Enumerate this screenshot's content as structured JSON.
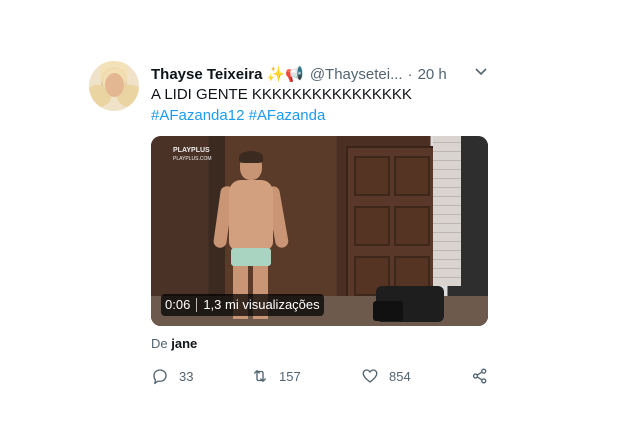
{
  "tweet": {
    "author_name": "Thayse Teixeira",
    "author_emojis": "✨📢",
    "handle": "@Thaysetei...",
    "separator": "·",
    "time": "20 h",
    "text": "A LIDI GENTE KKKKKKKKKKKKKKKK",
    "hashtags": [
      "#AFazanda12",
      "#AFazanda"
    ],
    "video": {
      "logo_text": "PLAYPLUS",
      "logo_sub": "PLAYPLUS.COM",
      "duration": "0:06",
      "views": "1,3 mi visualizações"
    },
    "via_prefix": "De",
    "via_source": "jane",
    "actions": {
      "replies": "33",
      "retweets": "157",
      "likes": "854"
    }
  },
  "icons": {
    "caret": "chevron-down-icon",
    "reply": "reply-icon",
    "retweet": "retweet-icon",
    "like": "heart-icon",
    "share": "share-icon"
  },
  "colors": {
    "link": "#1d9bf0",
    "secondary_text": "#536471",
    "primary_text": "#0f1419"
  }
}
